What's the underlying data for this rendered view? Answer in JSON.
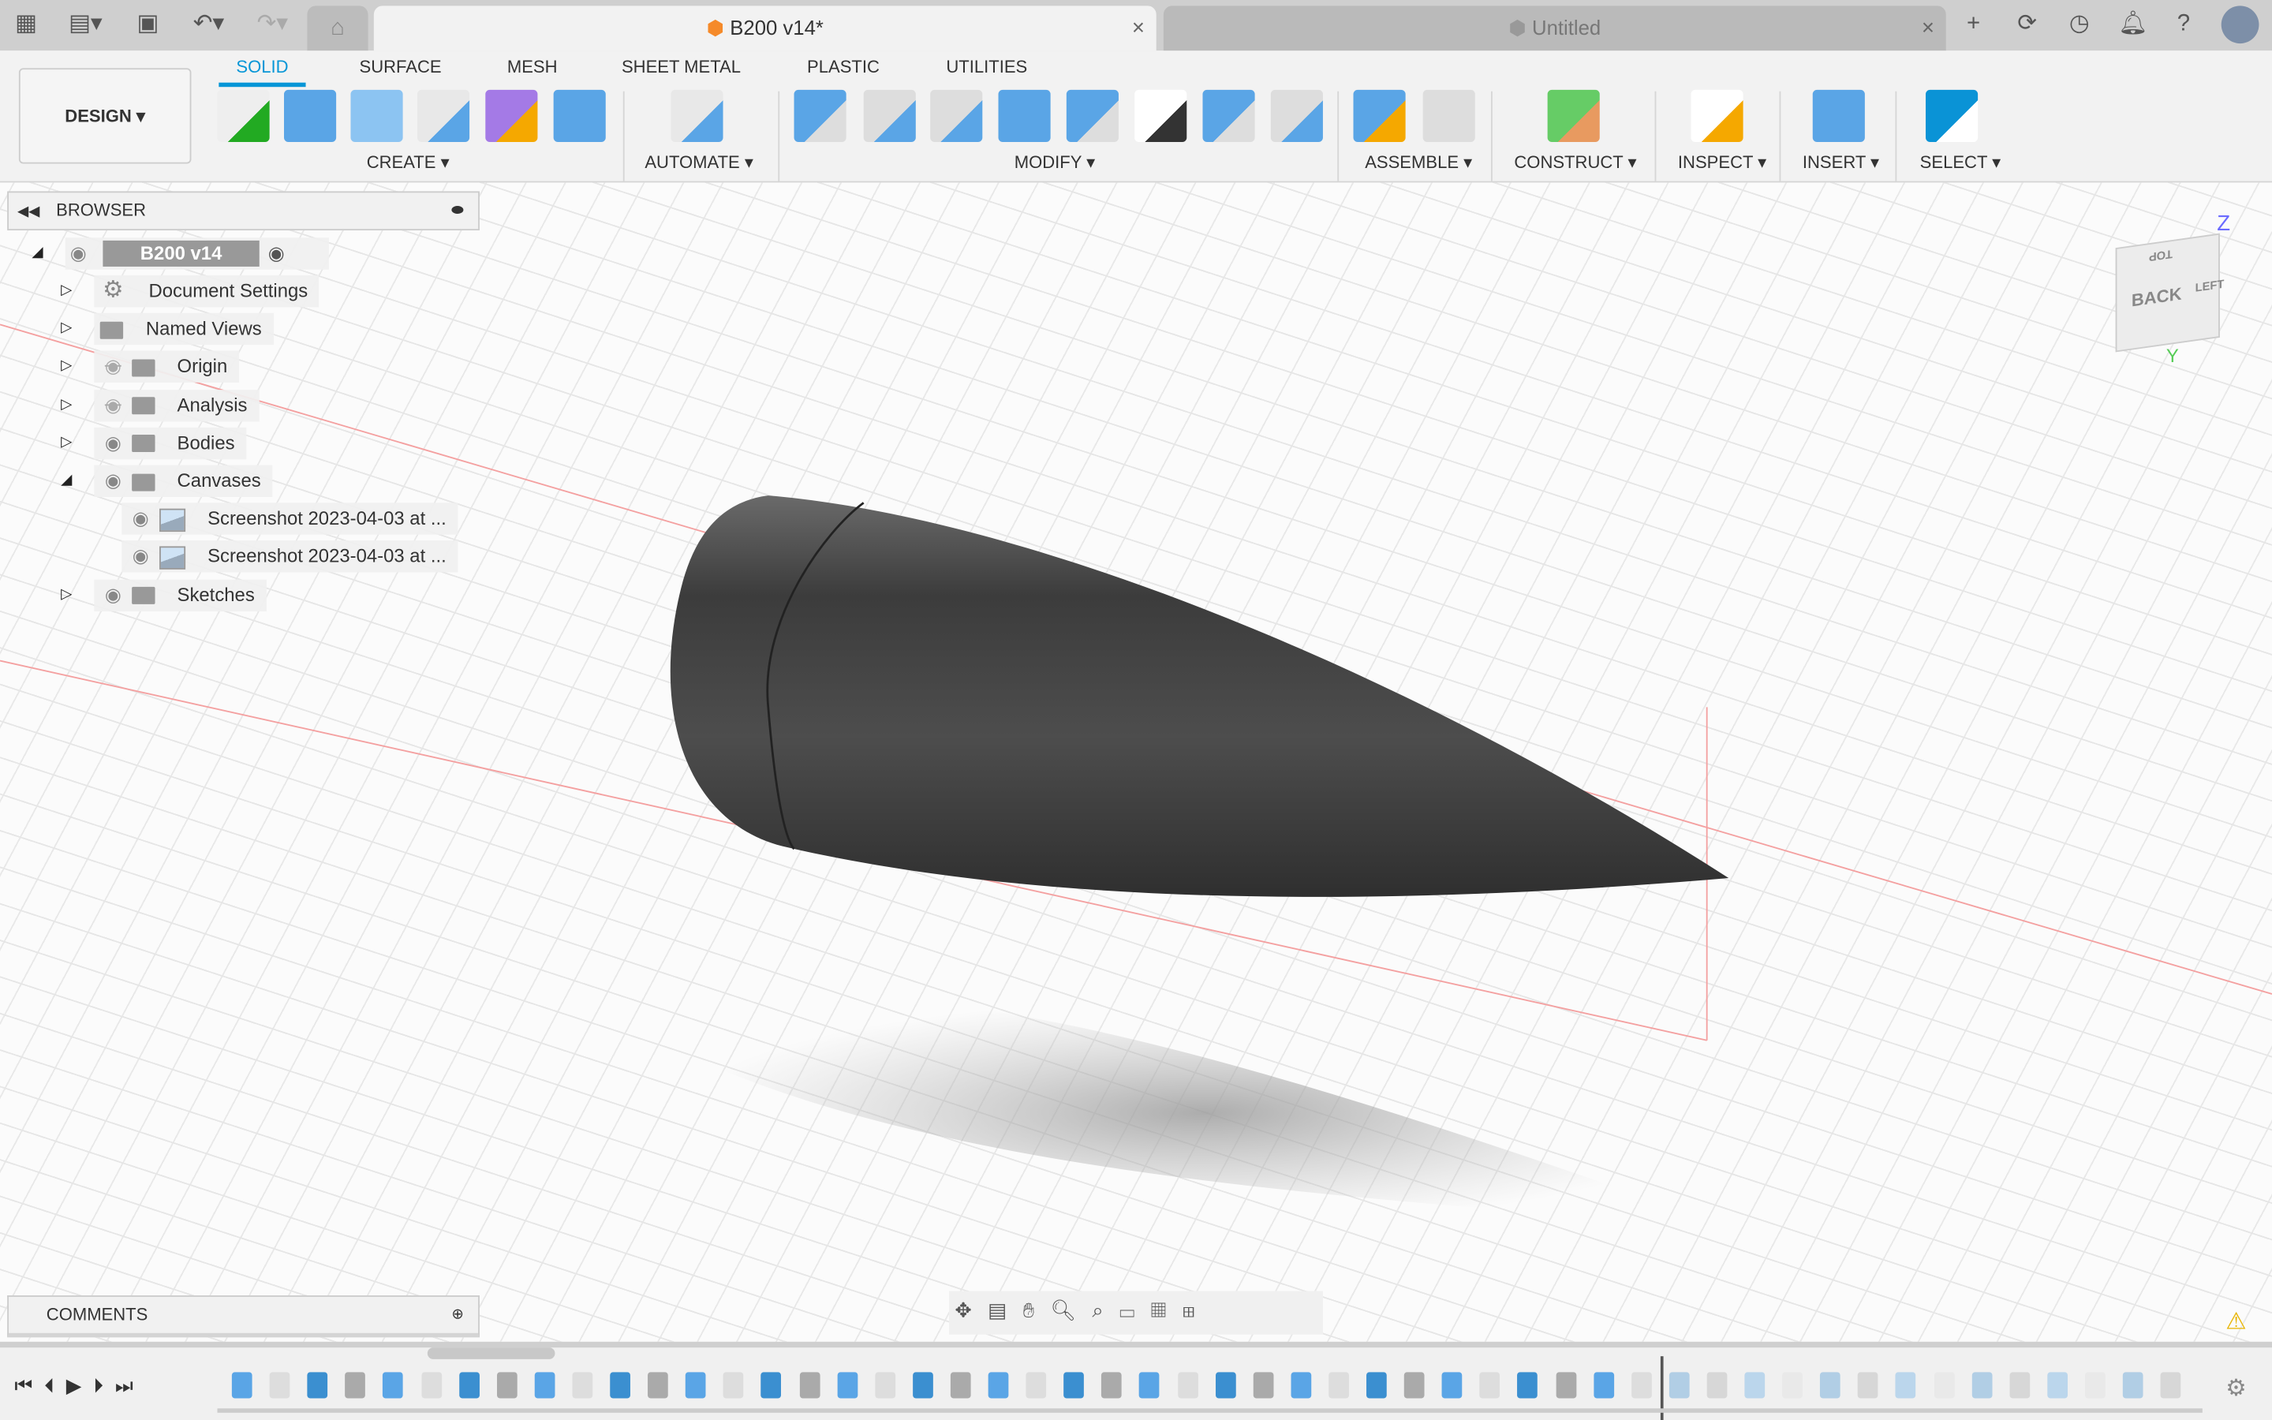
{
  "tabs": [
    {
      "label": "B200 v14*",
      "active": true
    },
    {
      "label": "Untitled",
      "active": false
    }
  ],
  "close_glyph": "×",
  "workspace": {
    "label": "DESIGN ▾"
  },
  "ribbon_tabs": [
    "SOLID",
    "SURFACE",
    "MESH",
    "SHEET METAL",
    "PLASTIC",
    "UTILITIES"
  ],
  "groups": [
    "CREATE ▾",
    "AUTOMATE ▾",
    "MODIFY ▾",
    "ASSEMBLE ▾",
    "CONSTRUCT ▾",
    "INSPECT ▾",
    "INSERT ▾",
    "SELECT ▾"
  ],
  "browser": {
    "title": "BROWSER",
    "root": "B200 v14",
    "items": [
      {
        "label": "Document Settings",
        "icon": "gear-icon"
      },
      {
        "label": "Named Views",
        "icon": "folder-icon"
      },
      {
        "label": "Origin",
        "icon": "folder-icon",
        "visible": false
      },
      {
        "label": "Analysis",
        "icon": "folder-icon",
        "visible": false
      },
      {
        "label": "Bodies",
        "icon": "folder-icon",
        "visible": true
      },
      {
        "label": "Canvases",
        "icon": "folder-icon",
        "visible": true,
        "expanded": true
      },
      {
        "label": "Screenshot 2023-04-03 at ...",
        "icon": "canvas-image-icon",
        "visible": true
      },
      {
        "label": "Screenshot 2023-04-03 at ...",
        "icon": "canvas-image-icon",
        "visible": true
      },
      {
        "label": "Sketches",
        "icon": "folder-icon",
        "visible": true
      }
    ]
  },
  "viewcube": {
    "faces": [
      "TOP",
      "BACK",
      "LEFT"
    ],
    "axes": [
      "Z",
      "Y"
    ]
  },
  "comments": {
    "title": "COMMENTS"
  },
  "colors": {
    "accent": "#0696d7",
    "body": "#4a4a4a",
    "axis_red": "#f08080"
  }
}
